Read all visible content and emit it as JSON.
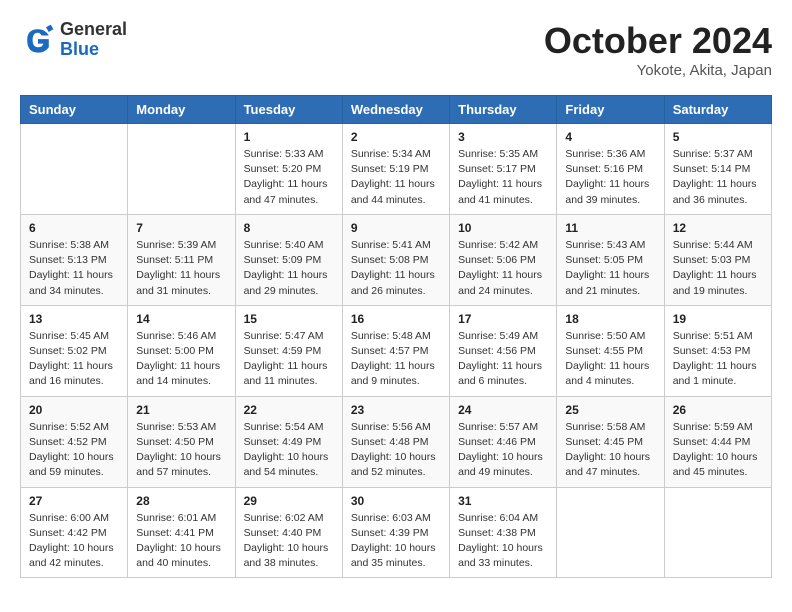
{
  "header": {
    "title": "October 2024",
    "location": "Yokote, Akita, Japan",
    "logo_general": "General",
    "logo_blue": "Blue"
  },
  "weekdays": [
    "Sunday",
    "Monday",
    "Tuesday",
    "Wednesday",
    "Thursday",
    "Friday",
    "Saturday"
  ],
  "weeks": [
    [
      {
        "day": "",
        "info": ""
      },
      {
        "day": "",
        "info": ""
      },
      {
        "day": "1",
        "info": "Sunrise: 5:33 AM\nSunset: 5:20 PM\nDaylight: 11 hours and 47 minutes."
      },
      {
        "day": "2",
        "info": "Sunrise: 5:34 AM\nSunset: 5:19 PM\nDaylight: 11 hours and 44 minutes."
      },
      {
        "day": "3",
        "info": "Sunrise: 5:35 AM\nSunset: 5:17 PM\nDaylight: 11 hours and 41 minutes."
      },
      {
        "day": "4",
        "info": "Sunrise: 5:36 AM\nSunset: 5:16 PM\nDaylight: 11 hours and 39 minutes."
      },
      {
        "day": "5",
        "info": "Sunrise: 5:37 AM\nSunset: 5:14 PM\nDaylight: 11 hours and 36 minutes."
      }
    ],
    [
      {
        "day": "6",
        "info": "Sunrise: 5:38 AM\nSunset: 5:13 PM\nDaylight: 11 hours and 34 minutes."
      },
      {
        "day": "7",
        "info": "Sunrise: 5:39 AM\nSunset: 5:11 PM\nDaylight: 11 hours and 31 minutes."
      },
      {
        "day": "8",
        "info": "Sunrise: 5:40 AM\nSunset: 5:09 PM\nDaylight: 11 hours and 29 minutes."
      },
      {
        "day": "9",
        "info": "Sunrise: 5:41 AM\nSunset: 5:08 PM\nDaylight: 11 hours and 26 minutes."
      },
      {
        "day": "10",
        "info": "Sunrise: 5:42 AM\nSunset: 5:06 PM\nDaylight: 11 hours and 24 minutes."
      },
      {
        "day": "11",
        "info": "Sunrise: 5:43 AM\nSunset: 5:05 PM\nDaylight: 11 hours and 21 minutes."
      },
      {
        "day": "12",
        "info": "Sunrise: 5:44 AM\nSunset: 5:03 PM\nDaylight: 11 hours and 19 minutes."
      }
    ],
    [
      {
        "day": "13",
        "info": "Sunrise: 5:45 AM\nSunset: 5:02 PM\nDaylight: 11 hours and 16 minutes."
      },
      {
        "day": "14",
        "info": "Sunrise: 5:46 AM\nSunset: 5:00 PM\nDaylight: 11 hours and 14 minutes."
      },
      {
        "day": "15",
        "info": "Sunrise: 5:47 AM\nSunset: 4:59 PM\nDaylight: 11 hours and 11 minutes."
      },
      {
        "day": "16",
        "info": "Sunrise: 5:48 AM\nSunset: 4:57 PM\nDaylight: 11 hours and 9 minutes."
      },
      {
        "day": "17",
        "info": "Sunrise: 5:49 AM\nSunset: 4:56 PM\nDaylight: 11 hours and 6 minutes."
      },
      {
        "day": "18",
        "info": "Sunrise: 5:50 AM\nSunset: 4:55 PM\nDaylight: 11 hours and 4 minutes."
      },
      {
        "day": "19",
        "info": "Sunrise: 5:51 AM\nSunset: 4:53 PM\nDaylight: 11 hours and 1 minute."
      }
    ],
    [
      {
        "day": "20",
        "info": "Sunrise: 5:52 AM\nSunset: 4:52 PM\nDaylight: 10 hours and 59 minutes."
      },
      {
        "day": "21",
        "info": "Sunrise: 5:53 AM\nSunset: 4:50 PM\nDaylight: 10 hours and 57 minutes."
      },
      {
        "day": "22",
        "info": "Sunrise: 5:54 AM\nSunset: 4:49 PM\nDaylight: 10 hours and 54 minutes."
      },
      {
        "day": "23",
        "info": "Sunrise: 5:56 AM\nSunset: 4:48 PM\nDaylight: 10 hours and 52 minutes."
      },
      {
        "day": "24",
        "info": "Sunrise: 5:57 AM\nSunset: 4:46 PM\nDaylight: 10 hours and 49 minutes."
      },
      {
        "day": "25",
        "info": "Sunrise: 5:58 AM\nSunset: 4:45 PM\nDaylight: 10 hours and 47 minutes."
      },
      {
        "day": "26",
        "info": "Sunrise: 5:59 AM\nSunset: 4:44 PM\nDaylight: 10 hours and 45 minutes."
      }
    ],
    [
      {
        "day": "27",
        "info": "Sunrise: 6:00 AM\nSunset: 4:42 PM\nDaylight: 10 hours and 42 minutes."
      },
      {
        "day": "28",
        "info": "Sunrise: 6:01 AM\nSunset: 4:41 PM\nDaylight: 10 hours and 40 minutes."
      },
      {
        "day": "29",
        "info": "Sunrise: 6:02 AM\nSunset: 4:40 PM\nDaylight: 10 hours and 38 minutes."
      },
      {
        "day": "30",
        "info": "Sunrise: 6:03 AM\nSunset: 4:39 PM\nDaylight: 10 hours and 35 minutes."
      },
      {
        "day": "31",
        "info": "Sunrise: 6:04 AM\nSunset: 4:38 PM\nDaylight: 10 hours and 33 minutes."
      },
      {
        "day": "",
        "info": ""
      },
      {
        "day": "",
        "info": ""
      }
    ]
  ]
}
